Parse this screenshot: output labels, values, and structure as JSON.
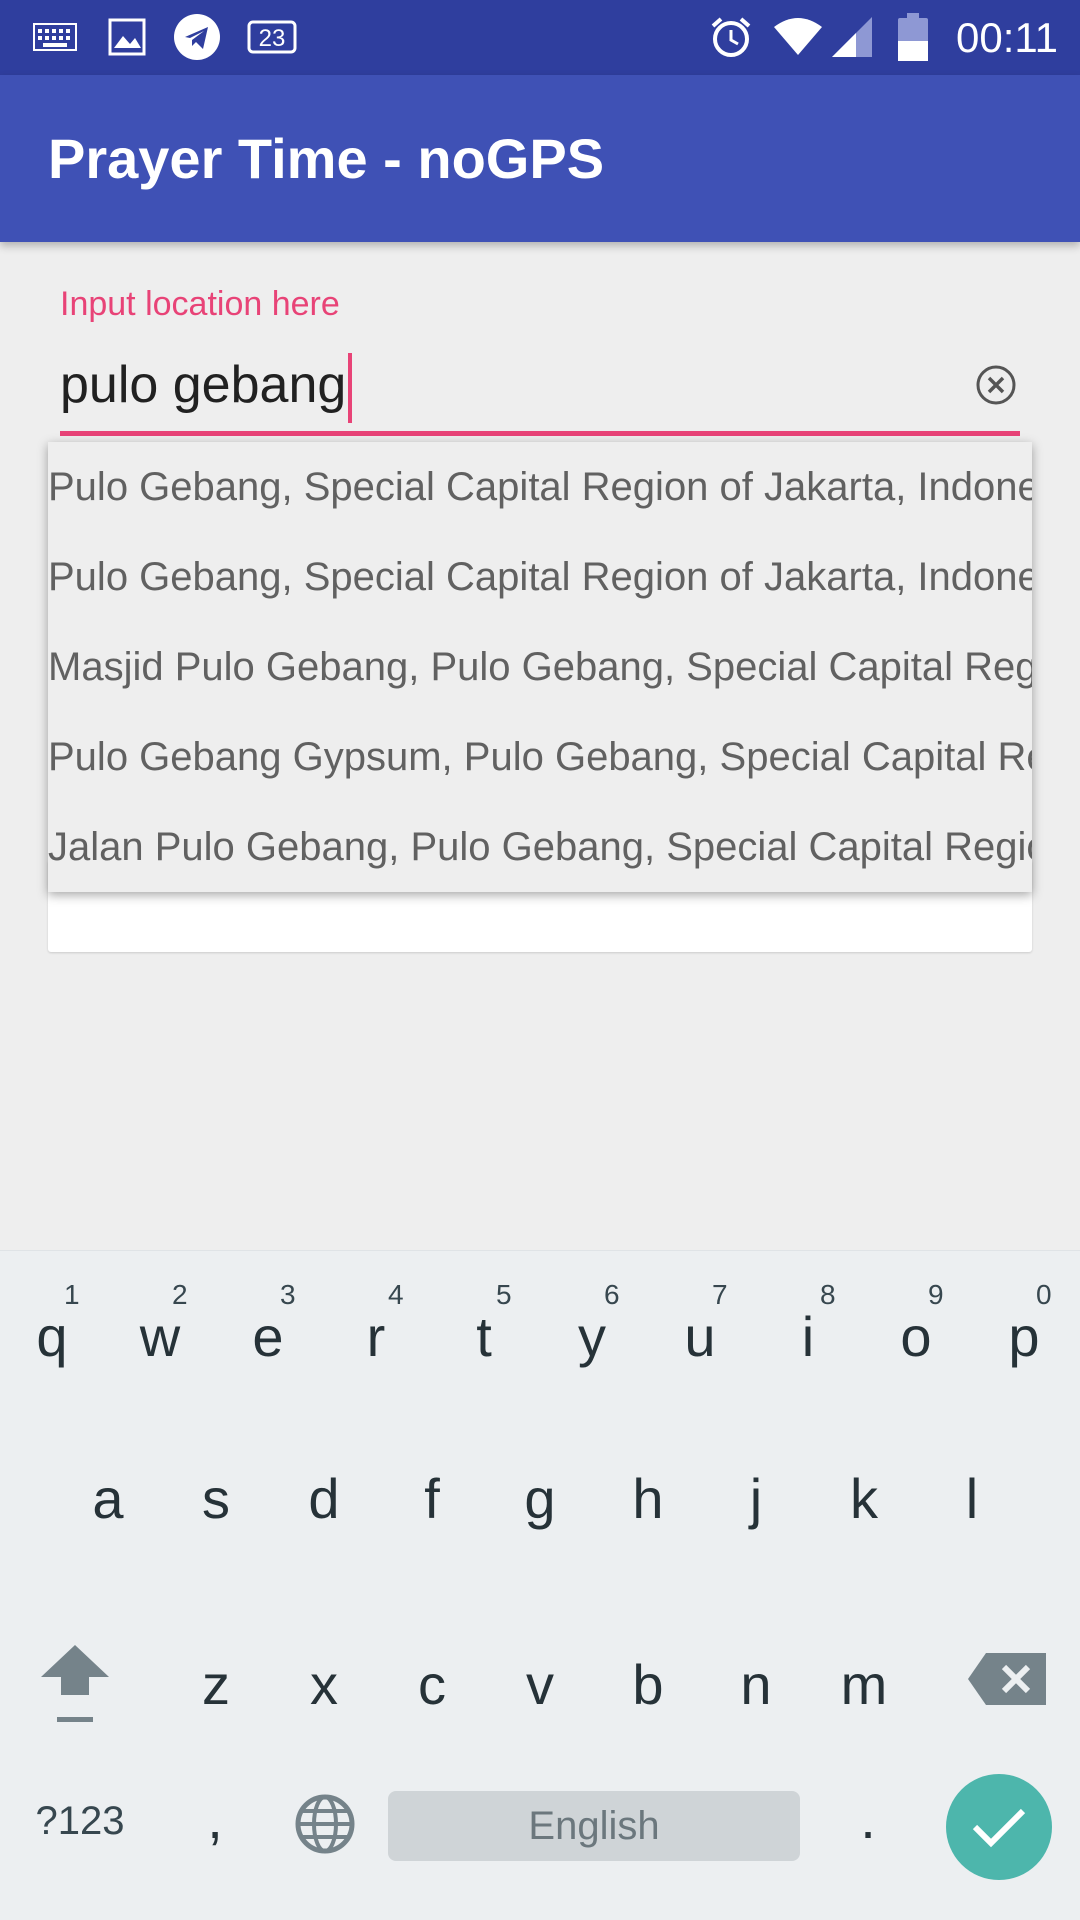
{
  "status_bar": {
    "time": "00:11",
    "notification_badge": "23",
    "icons": [
      "keyboard-icon",
      "image-icon",
      "telegram-icon",
      "calendar-badge-icon",
      "alarm-icon",
      "wifi-icon",
      "signal-icon",
      "battery-icon"
    ]
  },
  "app_bar": {
    "title": "Prayer Time - noGPS"
  },
  "location_input": {
    "label": "Input location here",
    "value": "pulo gebang",
    "clear_icon": "clear-circle-icon"
  },
  "suggestions": [
    "Pulo Gebang, Special Capital Region of Jakarta, Indonesia",
    "Pulo Gebang, Special Capital Region of Jakarta, Indonesia",
    "Masjid Pulo Gebang, Pulo Gebang, Special Capital Region of Jakarta",
    "Pulo Gebang Gypsum, Pulo Gebang, Special Capital Region of Jakarta",
    "Jalan Pulo Gebang, Pulo Gebang, Special Capital Region of Jakarta"
  ],
  "keyboard": {
    "row1": [
      {
        "k": "q",
        "h": "1"
      },
      {
        "k": "w",
        "h": "2"
      },
      {
        "k": "e",
        "h": "3"
      },
      {
        "k": "r",
        "h": "4"
      },
      {
        "k": "t",
        "h": "5"
      },
      {
        "k": "y",
        "h": "6"
      },
      {
        "k": "u",
        "h": "7"
      },
      {
        "k": "i",
        "h": "8"
      },
      {
        "k": "o",
        "h": "9"
      },
      {
        "k": "p",
        "h": "0"
      }
    ],
    "row2": [
      "a",
      "s",
      "d",
      "f",
      "g",
      "h",
      "j",
      "k",
      "l"
    ],
    "row3": [
      "z",
      "x",
      "c",
      "v",
      "b",
      "n",
      "m"
    ],
    "symbols_label": "?123",
    "comma_label": ",",
    "period_label": ".",
    "space_label": "English",
    "accent_color": "#4db6ac"
  },
  "colors": {
    "status_bar": "#2f3e9e",
    "app_bar": "#3f51b5",
    "accent": "#e84377"
  }
}
